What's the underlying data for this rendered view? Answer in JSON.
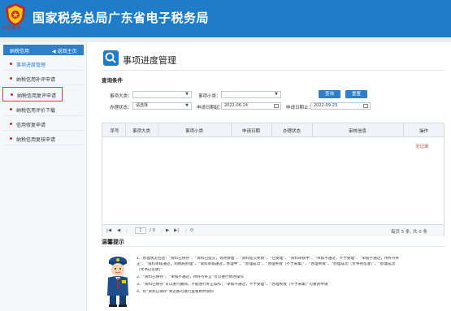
{
  "header": {
    "title": "国家税务总局广东省电子税务局",
    "logo_text": "中国税务"
  },
  "sidebar": {
    "title": "纳税信用",
    "back_label": "◀ 返回主页",
    "items": [
      {
        "label": "事项进度管理",
        "active": true
      },
      {
        "label": "纳税信用补评申请"
      },
      {
        "label": "纳税信用复评申请",
        "highlighted": true
      },
      {
        "label": "纳税信用评价下载"
      },
      {
        "label": "信用修复申请"
      },
      {
        "label": "纳税信用复核申请"
      }
    ]
  },
  "main": {
    "title": "事项进度管理",
    "query_title": "查询条件",
    "labels": {
      "major": "事项大类：",
      "minor": "事项小类：",
      "status": "办理状态：",
      "date_from": "申请日期起：",
      "date_to": "申请日期止："
    },
    "values": {
      "major": "",
      "minor": "",
      "status": "请选择",
      "date_from": "2022-06-24",
      "date_to": "2022-09-23"
    },
    "buttons": {
      "query": "查询",
      "reset": "重置"
    },
    "table": {
      "columns": [
        "序号",
        "事项大类",
        "事项小类",
        "申请日期",
        "办理状态",
        "审核信息",
        "操作"
      ],
      "empty_text": "无记录"
    },
    "pager": {
      "page": "1",
      "total_pages": "/ 0",
      "summary": "每页 5 条, 共 0 条"
    },
    "tips_title": "温馨提示",
    "tips": [
      "1、办理状态包括：“资料已保存”、“资料已提交，等待受理”、“资料提交失败”、“已受理”、“资料审核中”、“审核不通过，不予受理”、“审核不通过，待补齐补",
      "正”、“资料审核通过，到税局办理”、“资料审核通过，办理中”、“办理成功”、“办理失败（不予采集）”、“办理失败”、“办理成功（文书待签收）”、“办理成功",
      "（文书已签收）”",
      "2、“资料已保存”、“审核不通过，待补齐补正”可以进行修改操作",
      "3、“资料已保存”可以进行删除，不能进行补正操作；“审核不通过，不予受理”、“办理失败（不予采集）”可重新申请",
      "4、有“资料已保存”状态都可进行查看附件资料"
    ]
  }
}
